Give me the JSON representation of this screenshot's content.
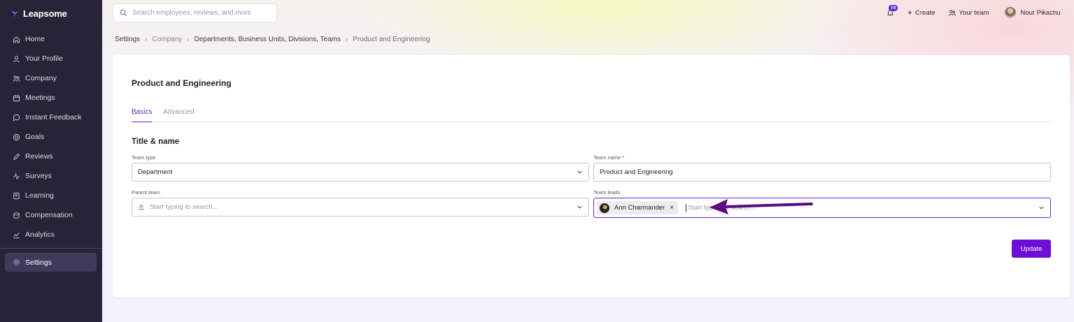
{
  "app": {
    "brand": "Leapsome"
  },
  "sidebar": {
    "items": [
      {
        "label": "Home",
        "icon": "home-icon"
      },
      {
        "label": "Your Profile",
        "icon": "user-icon"
      },
      {
        "label": "Company",
        "icon": "people-icon"
      },
      {
        "label": "Meetings",
        "icon": "calendar-icon"
      },
      {
        "label": "Instant Feedback",
        "icon": "chat-bubble-icon"
      },
      {
        "label": "Goals",
        "icon": "target-icon"
      },
      {
        "label": "Reviews",
        "icon": "pen-icon"
      },
      {
        "label": "Surveys",
        "icon": "pulse-icon"
      },
      {
        "label": "Learning",
        "icon": "book-icon"
      },
      {
        "label": "Compensation",
        "icon": "coins-icon"
      },
      {
        "label": "Analytics",
        "icon": "chart-icon"
      }
    ],
    "active": {
      "label": "Settings",
      "icon": "gear-icon"
    }
  },
  "search": {
    "placeholder": "Search employees, reviews, and more"
  },
  "header": {
    "notification_count": "74",
    "create_label": "Create",
    "team_label": "Your team",
    "user_name": "Nour Pikachu"
  },
  "breadcrumb": {
    "items": [
      "Settings",
      "Company",
      "Departments, Business Units, Divisions, Teams",
      "Product and Engineering"
    ]
  },
  "page": {
    "title": "Product and Engineering",
    "tabs": [
      "Basics",
      "Advanced"
    ],
    "active_tab": "Basics",
    "section_title": "Title & name"
  },
  "form": {
    "team_type": {
      "label": "Team type",
      "value": "Department"
    },
    "team_name": {
      "label": "Team name *",
      "value": "Product and Engineering"
    },
    "parent_team": {
      "label": "Parent team",
      "placeholder": "Start typing to search..."
    },
    "team_leads": {
      "label": "Team leads",
      "selected": [
        "Ann Charmander"
      ],
      "placeholder": "Start typing to search..."
    },
    "submit_label": "Update"
  },
  "colors": {
    "accent": "#6d0fd7",
    "sidebar_bg": "#272438",
    "annotation_arrow": "#5b0a84"
  }
}
